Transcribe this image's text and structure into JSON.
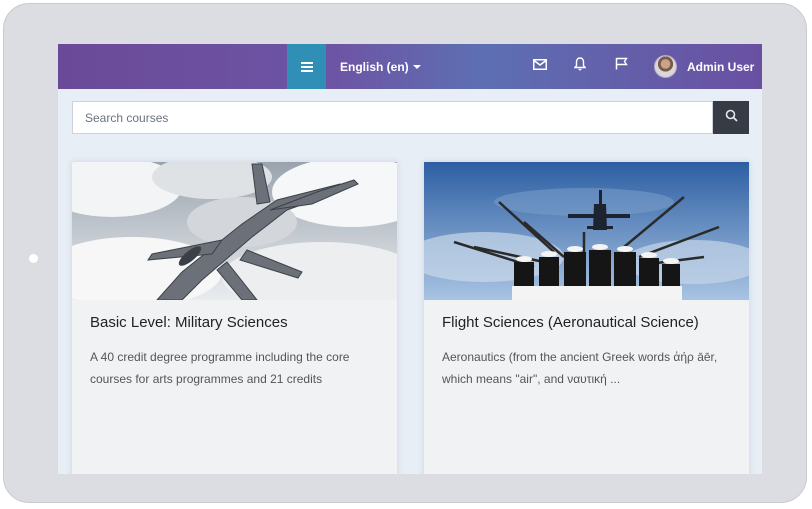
{
  "navbar": {
    "language": "English (en)",
    "user_name": "Admin User"
  },
  "icons": {
    "menu": "hamburger-icon",
    "messages": "envelope-icon",
    "notifications": "bell-icon",
    "flag": "flag-icon",
    "search": "search-icon"
  },
  "search": {
    "placeholder": "Search courses"
  },
  "courses": [
    {
      "title": "Basic Level: Military Sciences",
      "summary": "A 40 credit degree programme including the core courses for arts programmes and 21 credits"
    },
    {
      "title": "Flight Sciences (Aeronautical Science)",
      "summary": "Aeronautics (from the ancient Greek words ἀήρ āēr, which means \"air\", and ναυτική ..."
    }
  ],
  "colors": {
    "navbar_start": "#6a4a98",
    "navbar_end": "#6a50a2",
    "menu_button": "#2f8fb6",
    "search_button": "#363b46",
    "page_background": "#e8eef6"
  }
}
